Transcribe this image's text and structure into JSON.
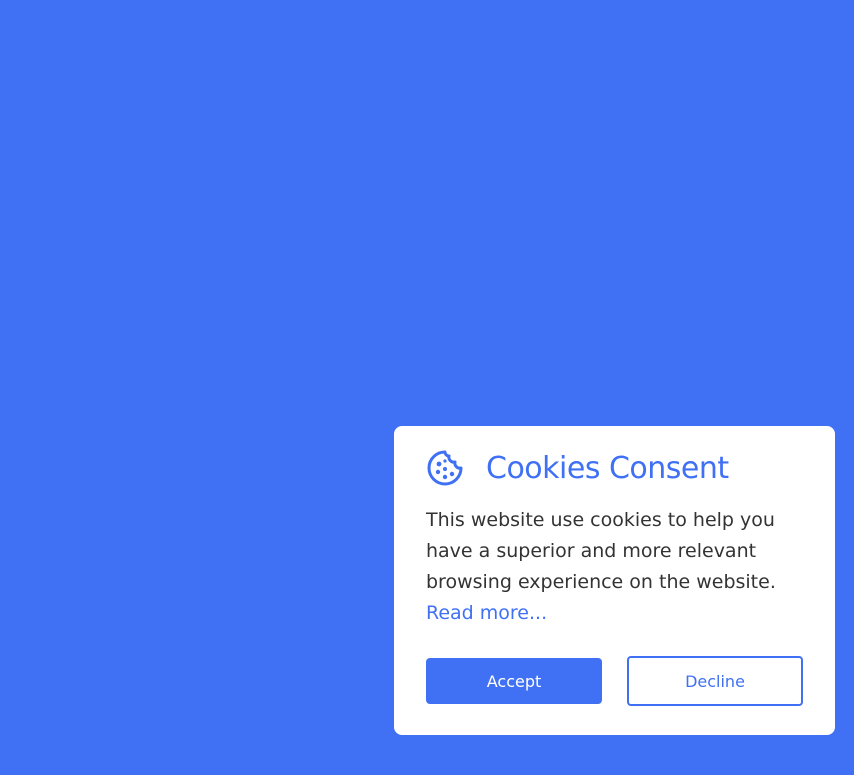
{
  "colors": {
    "background": "#4070f4",
    "accent": "#4070f4",
    "card": "#ffffff",
    "text": "#333333"
  },
  "consent": {
    "icon": "cookie-icon",
    "title": "Cookies Consent",
    "message": "This website use cookies to help you have a superior and more relevant browsing experience on the website. ",
    "read_more_label": "Read more...",
    "accept_label": "Accept",
    "decline_label": "Decline"
  }
}
